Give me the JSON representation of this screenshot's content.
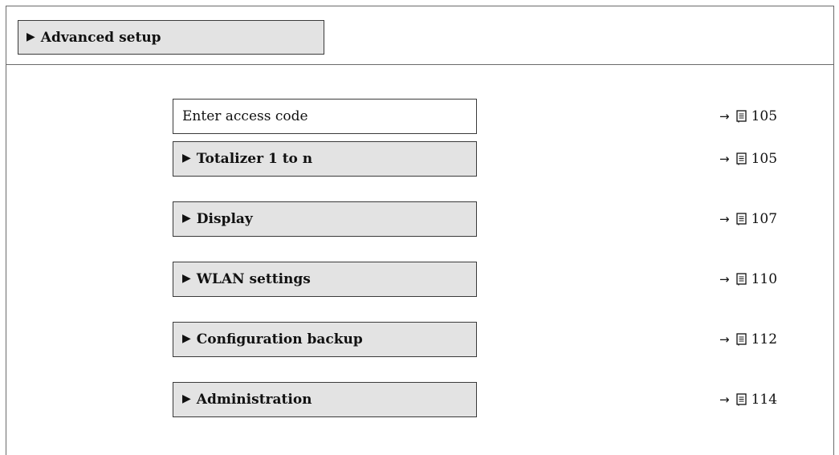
{
  "header": {
    "marker": "▶",
    "title": "Advanced setup"
  },
  "items": [
    {
      "kind": "param",
      "marker": "",
      "label": "Enter access code",
      "arrow": "→",
      "page": "105"
    },
    {
      "kind": "submenu",
      "marker": "▶",
      "label": "Totalizer 1 to n",
      "arrow": "→",
      "page": "105"
    },
    {
      "kind": "submenu",
      "marker": "▶",
      "label": "Display",
      "arrow": "→",
      "page": "107"
    },
    {
      "kind": "submenu",
      "marker": "▶",
      "label": "WLAN settings",
      "arrow": "→",
      "page": "110"
    },
    {
      "kind": "submenu",
      "marker": "▶",
      "label": "Configuration backup",
      "arrow": "→",
      "page": "112"
    },
    {
      "kind": "submenu",
      "marker": "▶",
      "label": "Administration",
      "arrow": "→",
      "page": "114"
    }
  ],
  "icons": {
    "triangle": "play-triangle-icon",
    "arrow": "right-arrow-icon",
    "page": "book-page-icon"
  }
}
